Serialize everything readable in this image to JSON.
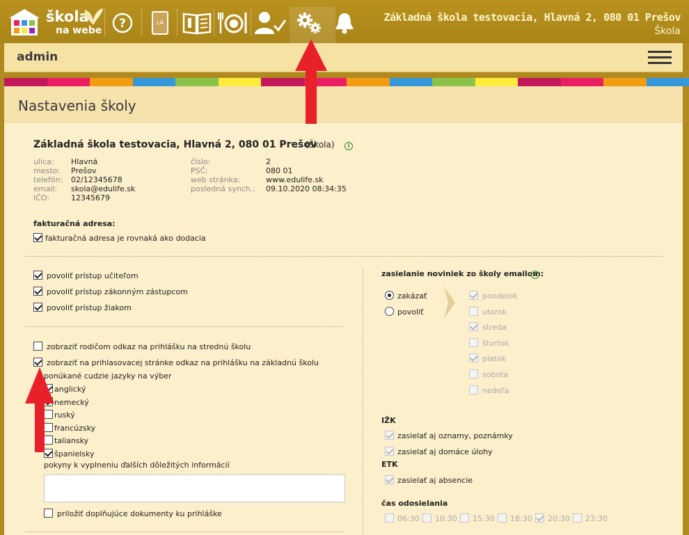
{
  "header": {
    "logo_word1": "škola",
    "logo_word2": "na webe",
    "school_title": "Základná škola testovacia, Hlavná 2, 080 01 Prešov",
    "school_type": "Škola",
    "nav_icons": [
      "help-icon",
      "diary-icon",
      "book-icon",
      "dining-icon",
      "teacher-icon",
      "settings-icon",
      "bell-icon"
    ]
  },
  "user": {
    "name": "admin"
  },
  "colors": [
    "#c2185b",
    "#e91e63",
    "#f39c12",
    "#3498db",
    "#8bc34a",
    "#ffeb3b",
    "#c2185b",
    "#e91e63",
    "#f39c12",
    "#3498db",
    "#8bc34a",
    "#ffeb3b",
    "#c2185b",
    "#e91e63",
    "#f39c12",
    "#3498db"
  ],
  "page": {
    "title": "Nastavenia školy"
  },
  "school": {
    "name": "Základná škola testovacia, Hlavná 2, 080 01 Prešov",
    "type": "(Škola)",
    "fields_left": [
      {
        "label": "ulica:",
        "value": "Hlavná"
      },
      {
        "label": "mesto:",
        "value": "Prešov"
      },
      {
        "label": "telefón:",
        "value": "02/12345678"
      },
      {
        "label": "email:",
        "value": "skola@edulife.sk"
      },
      {
        "label": "IČO:",
        "value": "12345679"
      }
    ],
    "fields_right": [
      {
        "label": "číslo:",
        "value": "2"
      },
      {
        "label": "PSČ:",
        "value": "080 01"
      },
      {
        "label": "web stránka:",
        "value": "www.edulife.sk"
      },
      {
        "label": "posledná synch.:",
        "value": "09.10.2020 08:34:35"
      }
    ]
  },
  "billing": {
    "heading": "fakturačná adresa:",
    "same_label": "fakturačná adresa je rovnaká ako dodacia"
  },
  "access": [
    {
      "label": "povoliť prístup učiteľom",
      "checked": true
    },
    {
      "label": "povoliť prístup zákonným zástupcom",
      "checked": true
    },
    {
      "label": "povoliť prístup žiakom",
      "checked": true
    }
  ],
  "application": {
    "parent_link_label": "zobraziť rodičom odkaz na prihlášku na strednú školu",
    "primary_link_label": "zobraziť na prihlasovacej stránke odkaz na prihlášku na základnú školu",
    "languages_heading": "ponúkané cudzie jazyky na výber",
    "languages": [
      {
        "label": "anglický",
        "checked": true
      },
      {
        "label": "nemecký",
        "checked": true
      },
      {
        "label": "ruský",
        "checked": false
      },
      {
        "label": "francúzsky",
        "checked": false
      },
      {
        "label": "taliansky",
        "checked": false
      },
      {
        "label": "španielsky",
        "checked": true
      }
    ],
    "instructions_label": "pokyny k vyplneniu ďalších dôležitých informácií",
    "attach_label": "priložiť doplňujúce dokumenty ku prihláške"
  },
  "newsletter": {
    "heading": "zasielanie noviniek zo školy emailom:",
    "options": [
      "zakázať",
      "povoliť"
    ],
    "days": [
      {
        "label": "pondelok",
        "checked": true
      },
      {
        "label": "utorok",
        "checked": false
      },
      {
        "label": "streda",
        "checked": true
      },
      {
        "label": "štvrtok",
        "checked": false
      },
      {
        "label": "piatok",
        "checked": true
      },
      {
        "label": "sobota",
        "checked": false
      },
      {
        "label": "nedeľa",
        "checked": false
      }
    ],
    "izk_heading": "IŽK",
    "izk_items": [
      "zasielať aj oznamy, poznámky",
      "zasielať aj domáce úlohy"
    ],
    "etk_heading": "ETK",
    "etk_items": [
      "zasielať aj absencie"
    ],
    "time_heading": "čas odosielania",
    "times": [
      {
        "label": "06:30",
        "checked": false
      },
      {
        "label": "10:30",
        "checked": false
      },
      {
        "label": "15:30",
        "checked": false
      },
      {
        "label": "18:30",
        "checked": false
      },
      {
        "label": "20:30",
        "checked": true
      },
      {
        "label": "23:30",
        "checked": false
      }
    ]
  }
}
